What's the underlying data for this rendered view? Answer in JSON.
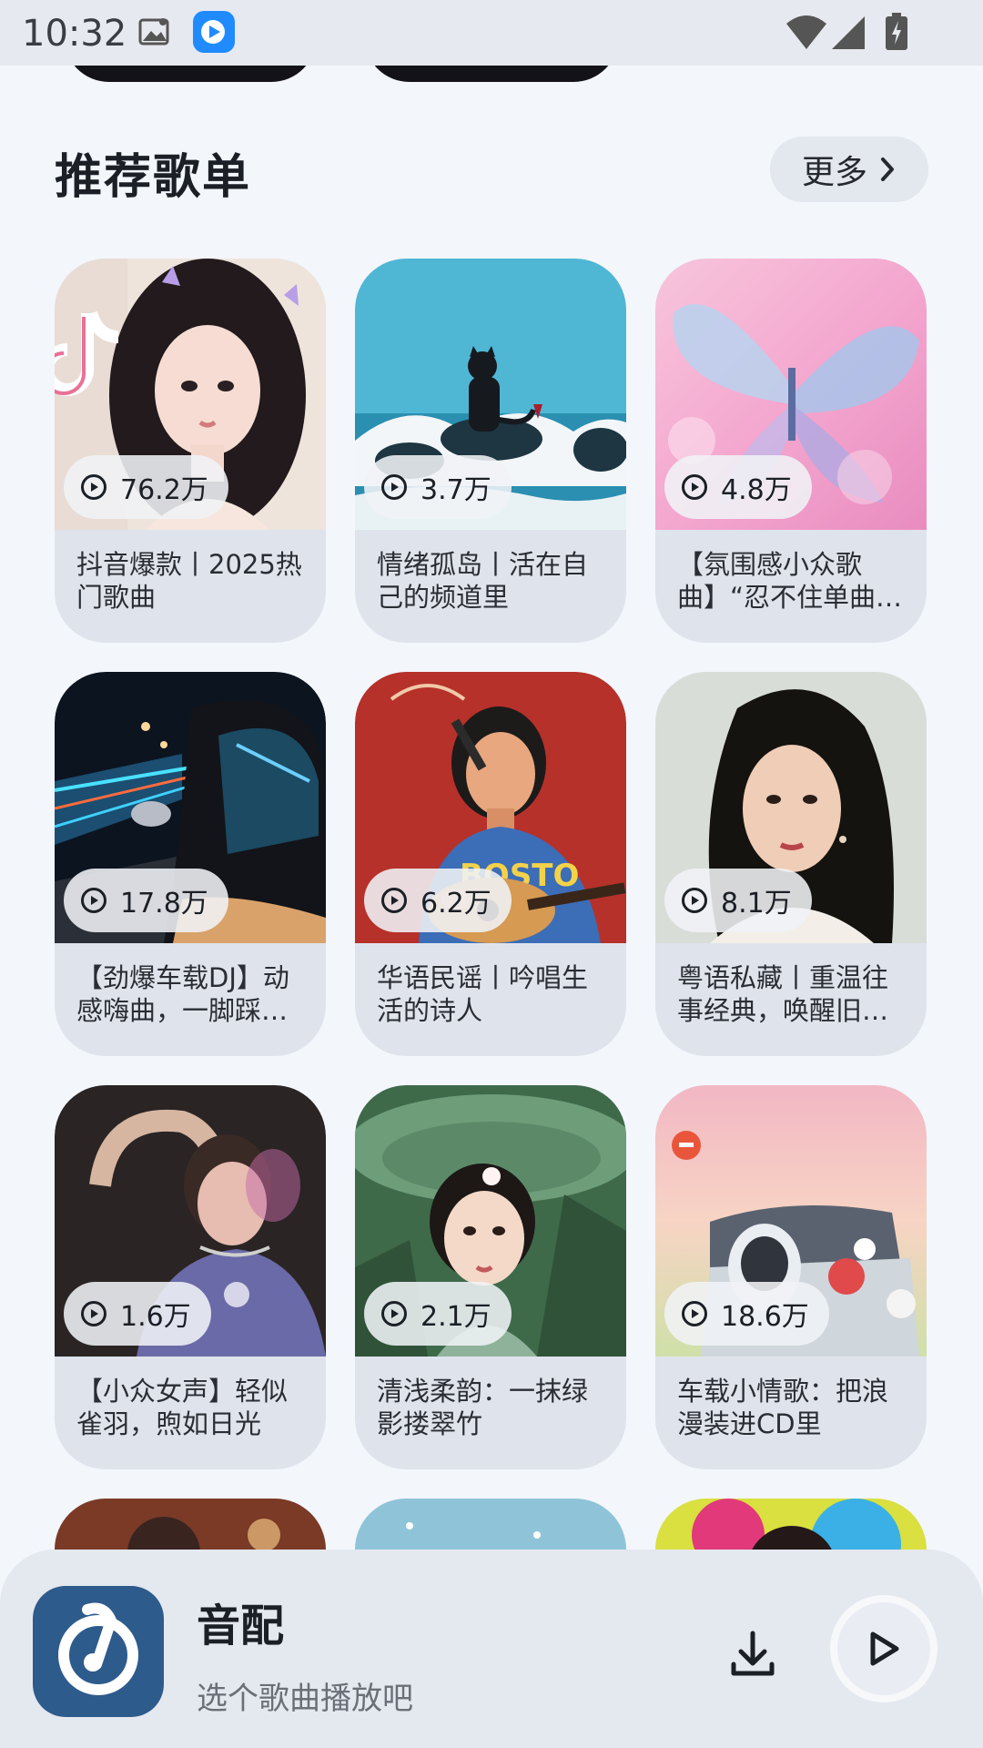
{
  "status_bar": {
    "time": "10:32",
    "icons": [
      "gallery-icon",
      "app-tv-icon",
      "wifi-icon",
      "signal-icon",
      "battery-charging-icon"
    ]
  },
  "section": {
    "title": "推荐歌单",
    "more_label": "更多",
    "more_icon": "chevron-right-icon"
  },
  "playlists": [
    {
      "plays": "76.2万",
      "title": "抖音爆款丨2025热门歌曲"
    },
    {
      "plays": "3.7万",
      "title": "情绪孤岛丨活在自己的频道里"
    },
    {
      "plays": "4.8万",
      "title": "【氛围感小众歌曲】“忍不住单曲…"
    },
    {
      "plays": "17.8万",
      "title": "【劲爆车载DJ】动感嗨曲，一脚踩…"
    },
    {
      "plays": "6.2万",
      "title": "华语民谣丨吟唱生活的诗人"
    },
    {
      "plays": "8.1万",
      "title": "粤语私藏丨重温往事经典，唤醒旧…"
    },
    {
      "plays": "1.6万",
      "title": "【小众女声】轻似雀羽，煦如日光"
    },
    {
      "plays": "2.1万",
      "title": "清浅柔韵：一抹绿影搂翠竹"
    },
    {
      "plays": "18.6万",
      "title": "车载小情歌：把浪漫装进CD里"
    }
  ],
  "player": {
    "title": "音配",
    "subtitle": "选个歌曲播放吧",
    "download_icon": "download-icon",
    "play_icon": "play-icon"
  },
  "colors": {
    "background": "#f3f6fb",
    "card": "#dfe4ec",
    "player": "#e4e8ef",
    "logo": "#2d5b8c"
  }
}
